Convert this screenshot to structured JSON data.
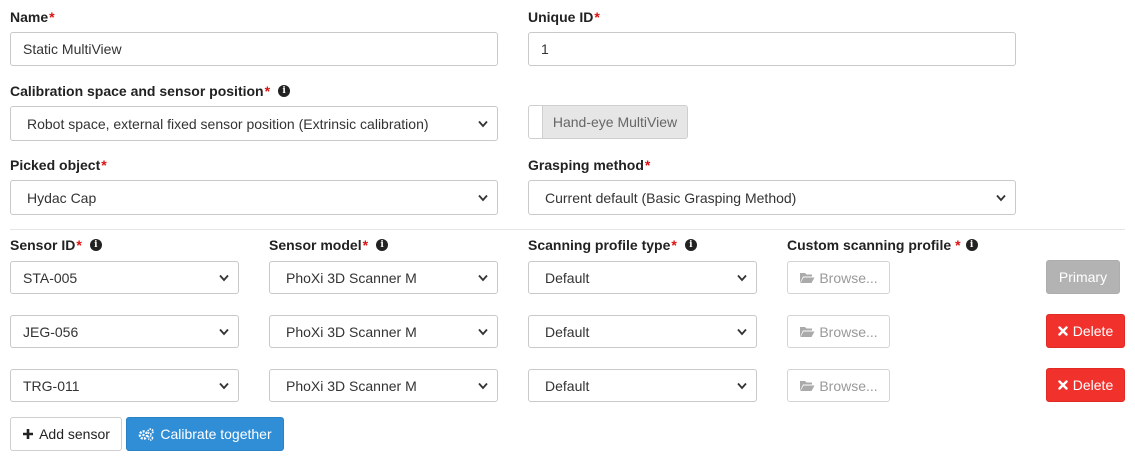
{
  "name": {
    "label": "Name",
    "value": "Static MultiView"
  },
  "unique_id": {
    "label": "Unique ID",
    "value": "1"
  },
  "calibration": {
    "label": "Calibration space and sensor position",
    "value": "Robot space, external fixed sensor position (Extrinsic calibration)"
  },
  "hand_eye_toggle": {
    "label": "Hand-eye MultiView",
    "on": false
  },
  "picked_object": {
    "label": "Picked object",
    "value": "Hydac Cap"
  },
  "grasping": {
    "label": "Grasping method",
    "value": "Current default (Basic Grasping Method)"
  },
  "headers": {
    "sensor_id": "Sensor ID",
    "sensor_model": "Sensor model",
    "scanning_profile_type": "Scanning profile type",
    "custom_profile": "Custom scanning profile"
  },
  "sensors": [
    {
      "id": "STA-005",
      "model": "PhoXi 3D Scanner M",
      "profile": "Default",
      "browse": "Browse...",
      "action": "Primary"
    },
    {
      "id": "JEG-056",
      "model": "PhoXi 3D Scanner M",
      "profile": "Default",
      "browse": "Browse...",
      "action": "Delete"
    },
    {
      "id": "TRG-011",
      "model": "PhoXi 3D Scanner M",
      "profile": "Default",
      "browse": "Browse...",
      "action": "Delete"
    }
  ],
  "buttons": {
    "add_sensor": "Add sensor",
    "calibrate": "Calibrate together"
  },
  "colors": {
    "required": "#dd1111",
    "danger": "#f1312c",
    "blue": "#2f8ed6",
    "disabled": "#b3b3b3"
  }
}
